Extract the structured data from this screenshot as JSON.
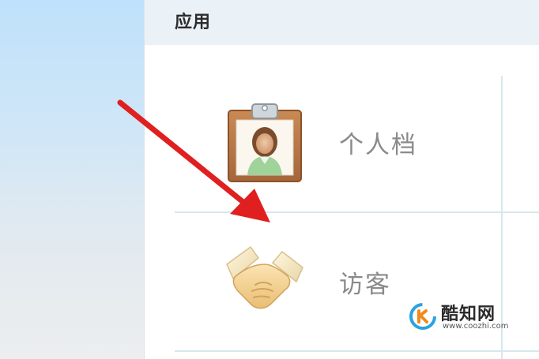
{
  "panel": {
    "title": "应用"
  },
  "apps": [
    {
      "label": "个人档",
      "icon": "clipboard-profile-icon"
    },
    {
      "label": "访客",
      "icon": "handshake-icon"
    }
  ],
  "annotation": {
    "arrow_color": "#e02020"
  },
  "watermark": {
    "name": "酷知网",
    "url": "www.coozhi.com",
    "logo_colors": [
      "#2aa3e0",
      "#f08a1c"
    ]
  },
  "colors": {
    "header_bg": "#eaf2f8",
    "grid_line": "#d6e8ec",
    "label_text": "#8a8a8a"
  }
}
